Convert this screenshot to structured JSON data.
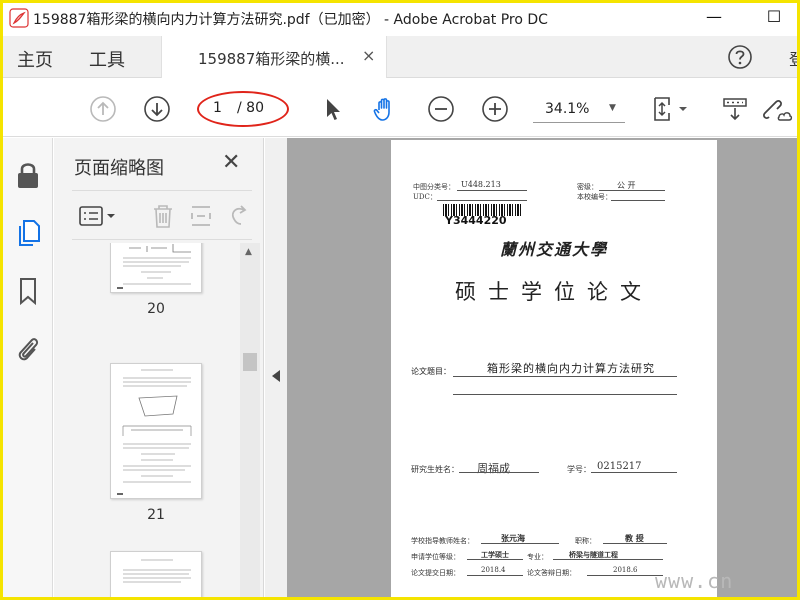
{
  "window": {
    "title": "159887箱形梁的横向内力计算方法研究.pdf（已加密） - Adobe Acrobat Pro DC",
    "minimize_glyph": "—",
    "maximize_glyph": "☐"
  },
  "tabs": {
    "home": "主页",
    "tools": "工具",
    "document": "159887箱形梁的横...",
    "close_glyph": "×",
    "signin_partial": "登"
  },
  "toolbar": {
    "current_page": "1",
    "total_pages": "/ 80",
    "zoom": "34.1%"
  },
  "thumbnails": {
    "title": "页面缩略图",
    "close_glyph": "✕",
    "pages": [
      "20",
      "21"
    ]
  },
  "document": {
    "class_no_label": "中图分类号：",
    "class_no_value": "U448.213",
    "udc_label": "UDC：",
    "security_label": "密级：",
    "security_value": "公 开",
    "school_no_label": "本校编号：",
    "barcode_text": "Y3444220",
    "university": "蘭州交通大學",
    "degree": "硕士学位论文",
    "thesis_title_label": "论文题目：",
    "thesis_title": "箱形梁的横向内力计算方法研究",
    "student_label": "研究生姓名：",
    "student_name": "周福成",
    "student_no_label": "学号：",
    "student_no": "0215217",
    "advisor_label": "学校指导教师姓名：",
    "advisor_name": "张元海",
    "title_label": "职称：",
    "advisor_title": "教 授",
    "degree_level_label": "申请学位等级：",
    "degree_level": "工学硕士",
    "major_label": "专业：",
    "major": "桥梁与隧道工程",
    "submit_label": "论文提交日期：",
    "submit_date": "2018.4",
    "defense_label": "论文答辩日期：",
    "defense_date": "2018.6"
  },
  "watermark": "www.cn",
  "colors": {
    "frame_border": "#f5e400",
    "annotation_oval": "#e0241a",
    "viewport_bg": "#a6a6a6",
    "icon_blue": "#1473e6"
  }
}
